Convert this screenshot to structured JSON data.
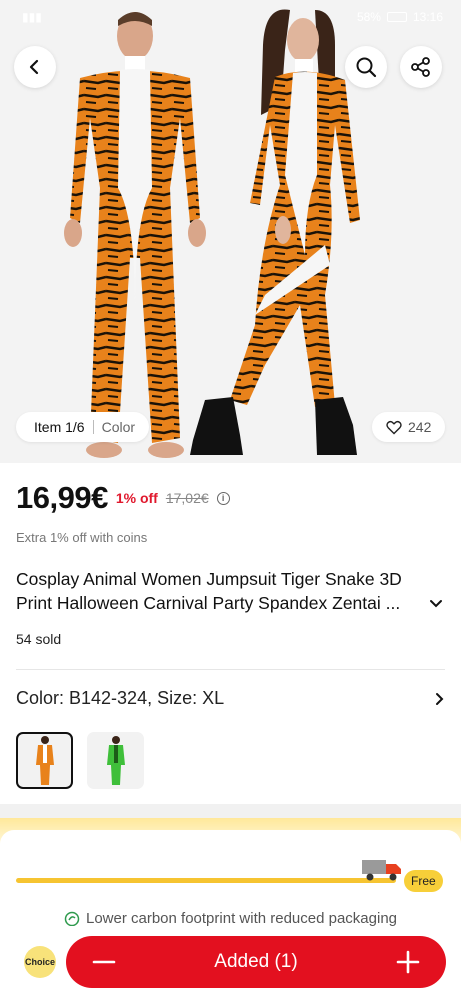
{
  "status_bar": {
    "time": "13:16",
    "battery": "58%"
  },
  "gallery": {
    "item_label": "Item 1/6",
    "color_label": "Color",
    "likes": "242"
  },
  "product": {
    "price": "16,99€",
    "discount": "1% off",
    "old_price": "17,02€",
    "coins_text": "Extra 1% off with coins",
    "title_line1": "Cosplay Animal Women Jumpsuit Tiger Snake 3D",
    "title_line2": "Print Halloween Carnival Party Spandex Zentai ...",
    "sold": "54 sold"
  },
  "variant": {
    "label": "Color: B142-324, Size: XL"
  },
  "shipping": {
    "free_label": "Free",
    "eco_text": "Lower carbon footprint with reduced packaging"
  },
  "bottom_bar": {
    "choice_label": "Choice",
    "cart_label": "Added (1)"
  },
  "colors": {
    "accent_red": "#e3101f",
    "discount_red": "#e0182d",
    "progress_yellow": "#f6c431"
  },
  "icons": [
    "back-icon",
    "search-icon",
    "share-icon",
    "heart-icon",
    "info-icon",
    "chevron-down-icon",
    "chevron-right-icon",
    "truck-icon",
    "eco-icon",
    "minus-icon",
    "plus-icon"
  ]
}
